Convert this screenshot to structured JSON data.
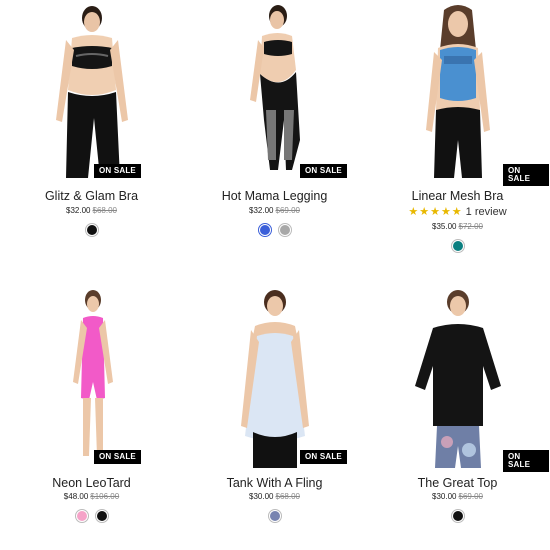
{
  "badge_label": "ON SALE",
  "products": [
    {
      "name": "Glitz & Glam Bra",
      "price": "$32.00",
      "old_price": "$68.00",
      "swatches": [
        "#111111"
      ]
    },
    {
      "name": "Hot Mama Legging",
      "price": "$32.00",
      "old_price": "$69.00",
      "swatches": [
        "#3b5fd9",
        "#a8a8a8"
      ]
    },
    {
      "name": "Linear Mesh Bra",
      "price": "$35.00",
      "old_price": "$72.00",
      "rating": {
        "stars": "★★★★★",
        "text": "1 review"
      },
      "swatches": [
        "#0a7f80"
      ]
    },
    {
      "name": "Neon LeoTard",
      "price": "$48.00",
      "old_price": "$106.00",
      "swatches": [
        "#f5a3c8",
        "#111111"
      ]
    },
    {
      "name": "Tank With A Fling",
      "price": "$30.00",
      "old_price": "$68.00",
      "swatches": [
        "#7884b0"
      ]
    },
    {
      "name": "The Great Top",
      "price": "$30.00",
      "old_price": "$69.00",
      "swatches": [
        "#111111"
      ]
    }
  ]
}
